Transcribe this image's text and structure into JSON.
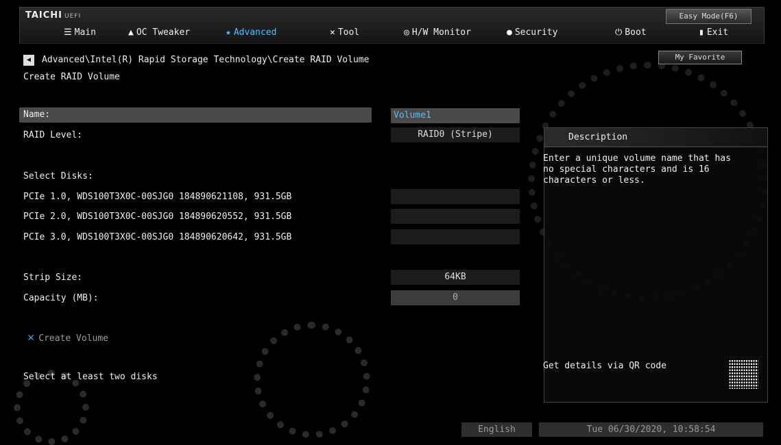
{
  "header": {
    "logo": "TAICHI",
    "logo_sub": "UEFI",
    "easy_mode": "Easy Mode(F6)",
    "tabs": [
      {
        "label": "Main",
        "icon": "list-icon"
      },
      {
        "label": "OC Tweaker",
        "icon": "rocket-icon"
      },
      {
        "label": "Advanced",
        "icon": "star-icon"
      },
      {
        "label": "Tool",
        "icon": "tools-icon"
      },
      {
        "label": "H/W Monitor",
        "icon": "monitor-icon"
      },
      {
        "label": "Security",
        "icon": "shield-icon"
      },
      {
        "label": "Boot",
        "icon": "power-icon"
      },
      {
        "label": "Exit",
        "icon": "exit-icon"
      }
    ],
    "active_tab": "Advanced",
    "accent_color": "#4ac3ff"
  },
  "breadcrumb": "Advanced\\Intel(R) Rapid Storage Technology\\Create RAID Volume",
  "page_title": "Create RAID Volume",
  "favorite": "My Favorite",
  "form": {
    "name_label": "Name:",
    "name_value": "Volume1",
    "raid_level_label": "RAID Level:",
    "raid_level_value": "RAID0 (Stripe)",
    "select_disks_label": "Select Disks:",
    "disks": [
      {
        "label": "PCIe 1.0, WDS100T3X0C-00SJG0 184890621108, 931.5GB",
        "value": ""
      },
      {
        "label": "PCIe 2.0, WDS100T3X0C-00SJG0 184890620552, 931.5GB",
        "value": ""
      },
      {
        "label": "PCIe 3.0, WDS100T3X0C-00SJG0 184890620642, 931.5GB",
        "value": ""
      }
    ],
    "strip_size_label": "Strip Size:",
    "strip_size_value": "64KB",
    "capacity_label": "Capacity (MB):",
    "capacity_value": "0",
    "create_volume": "Create Volume"
  },
  "status_message": "Select at least two disks",
  "description": {
    "title": "Description",
    "text": "Enter a unique volume name that has\nno special characters and is 16\ncharacters or less.",
    "qr_label": "Get details via QR code"
  },
  "footer": {
    "language": "English",
    "datetime": "Tue 06/30/2020, 10:58:54"
  }
}
